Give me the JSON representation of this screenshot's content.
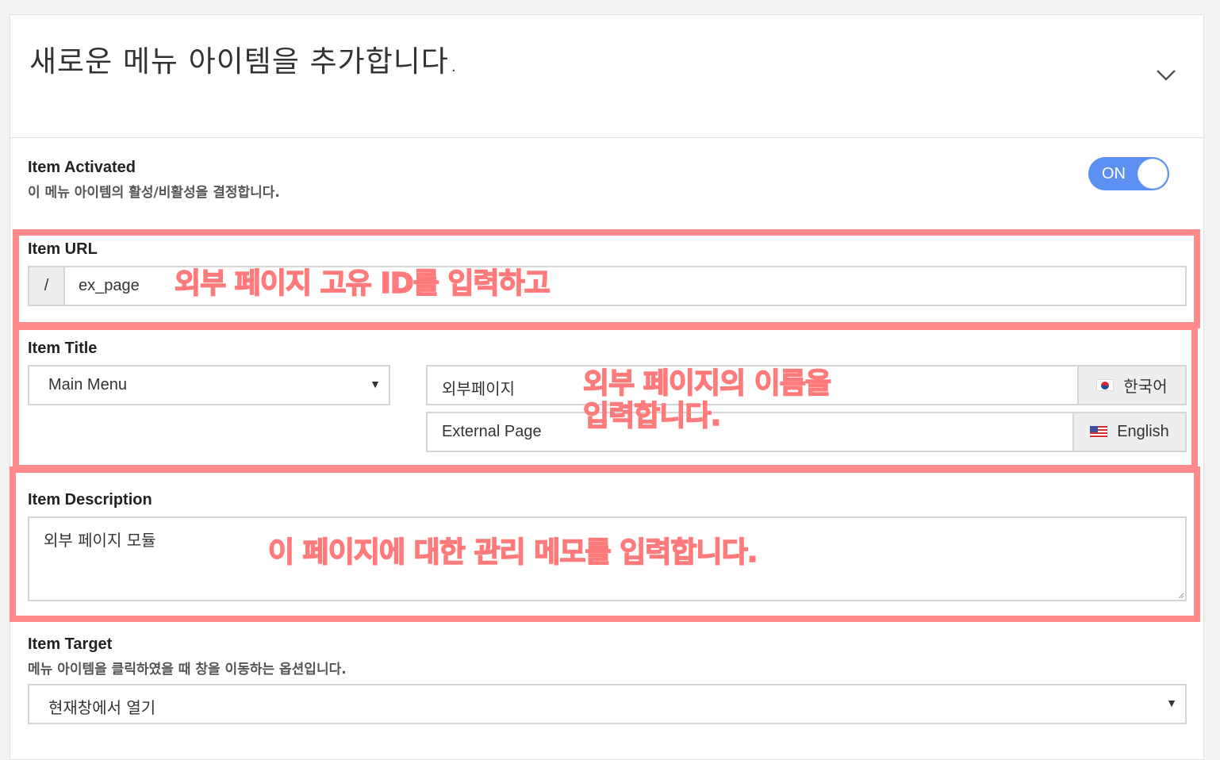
{
  "header": {
    "title": "새로운 메뉴 아이템을 추가합니다."
  },
  "activated": {
    "label": "Item Activated",
    "description": "이 메뉴 아이템의 활성/비활성을 결정합니다.",
    "toggle_label": "ON"
  },
  "url": {
    "label": "Item URL",
    "prefix": "/",
    "value": "ex_page",
    "annotation": "외부 페이지 고유 ID를 입력하고"
  },
  "title": {
    "label": "Item Title",
    "menu_select": "Main Menu",
    "korean_value": "외부페이지",
    "korean_lang": "한국어",
    "english_value": "External Page",
    "english_lang": "English",
    "annotation_line1": "외부 페이지의 이름을",
    "annotation_line2": "입력합니다."
  },
  "description": {
    "label": "Item Description",
    "value": "외부 페이지 모듈",
    "annotation": "이 페이지에 대한 관리 메모를 입력합니다."
  },
  "target": {
    "label": "Item Target",
    "description": "메뉴 아이템을 클릭하였을 때 창을 이동하는 옵션입니다.",
    "value": "현재창에서 열기"
  },
  "colors": {
    "accent": "#5b8ff0",
    "highlight": "#ff8a8a"
  }
}
